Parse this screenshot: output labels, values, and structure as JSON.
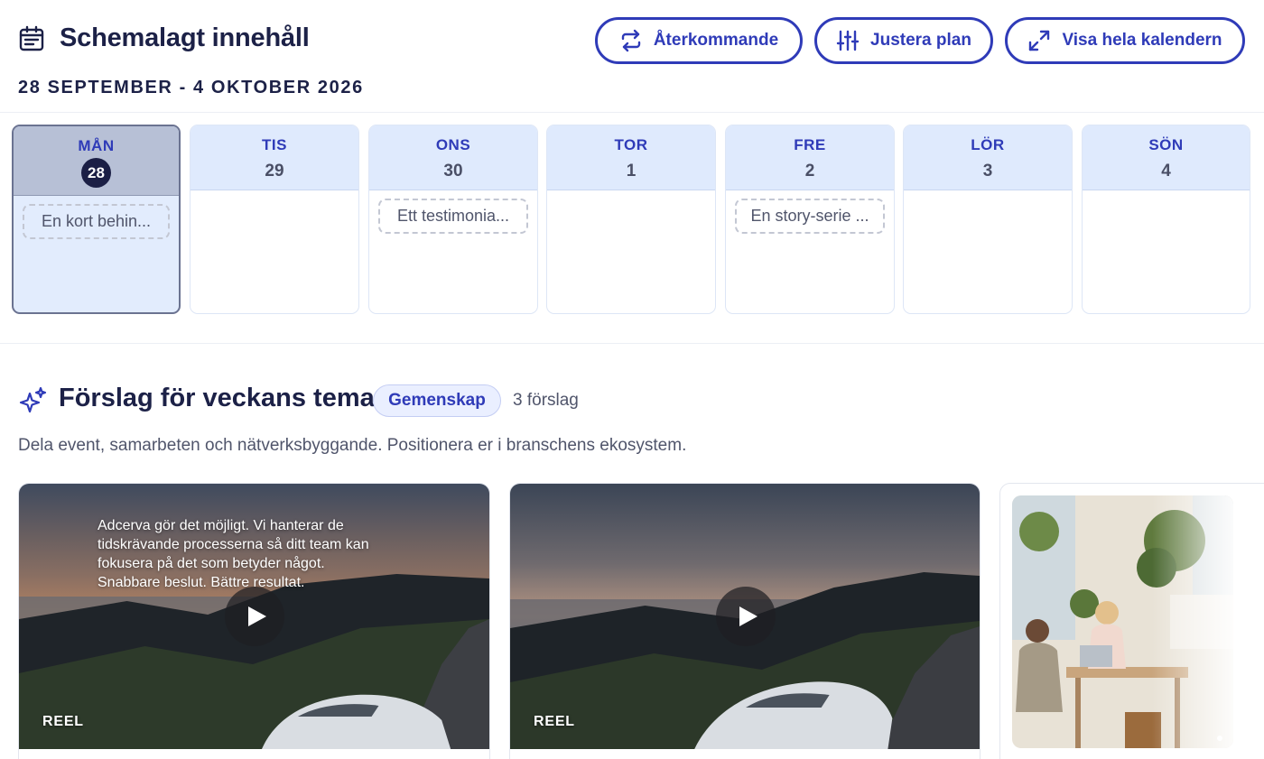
{
  "header": {
    "title": "Schemalagt innehåll",
    "date_range": "28 SEPTEMBER - 4 OKTOBER 2026",
    "buttons": {
      "recurring": "Återkommande",
      "adjust": "Justera plan",
      "calendar": "Visa hela kalendern"
    }
  },
  "week": [
    {
      "name": "MÅN",
      "num": "28",
      "today": true,
      "item": "En kort behin..."
    },
    {
      "name": "TIS",
      "num": "29",
      "item": ""
    },
    {
      "name": "ONS",
      "num": "30",
      "item": "Ett testimonia..."
    },
    {
      "name": "TOR",
      "num": "1",
      "item": ""
    },
    {
      "name": "FRE",
      "num": "2",
      "item": "En story-serie ..."
    },
    {
      "name": "LÖR",
      "num": "3",
      "item": ""
    },
    {
      "name": "SÖN",
      "num": "4",
      "item": ""
    }
  ],
  "suggestions": {
    "title": "Förslag för veckans tema",
    "theme": "Gemenskap",
    "count": "3 förslag",
    "description": "Dela event, samarbeten och nätverksbyggande. Positionera er i branschens ekosystem.",
    "cards": [
      {
        "overlay": "Adcerva gör det möjligt. Vi hanterar de tidskrävande processerna så ditt team kan fokusera på det som betyder något. Snabbare beslut. Bättre resultat.",
        "tag": "REEL"
      },
      {
        "overlay": "",
        "tag": "REEL"
      },
      {
        "overlay": "",
        "tag": ""
      }
    ]
  },
  "colors": {
    "accent": "#2f3bb8",
    "text": "#1c2147",
    "muted": "#50556b",
    "day_head": "#dfeafd",
    "today_head": "#b7c0d6"
  },
  "icons": {
    "title": "calendar-icon",
    "recurring": "repeat-icon",
    "adjust": "sliders-icon",
    "calendar": "expand-icon",
    "suggestions": "sparkle-icon",
    "play": "play-icon"
  }
}
